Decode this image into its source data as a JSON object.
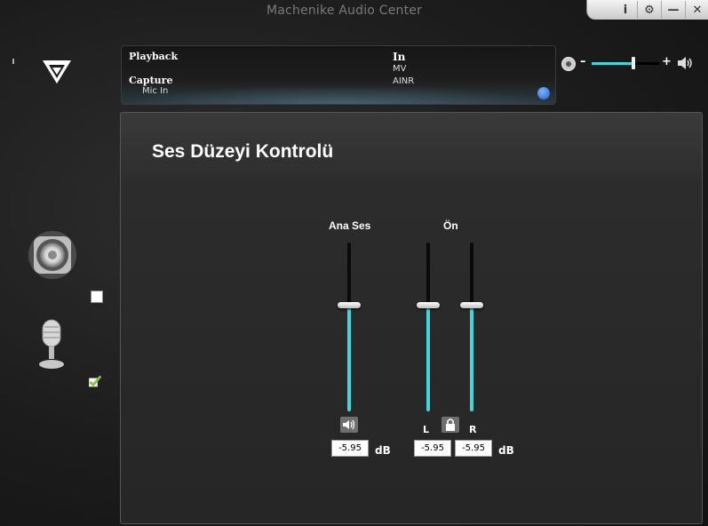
{
  "window": {
    "title": "Machenike Audio Center",
    "controls": [
      {
        "name": "info-button",
        "icon": "info-icon",
        "glyph": "i"
      },
      {
        "name": "settings-button",
        "icon": "gear-icon",
        "glyph": "⚙"
      },
      {
        "name": "minimize-button",
        "icon": "minimize-icon",
        "glyph": "—"
      },
      {
        "name": "close-button",
        "icon": "close-icon",
        "glyph": "✕"
      }
    ]
  },
  "status": {
    "playback_label": "Playback",
    "capture_label": "Capture",
    "capture_device": "Mic In",
    "in_label": "In",
    "in_items": [
      "MV",
      "AINR"
    ]
  },
  "master_volume": {
    "minus": "–",
    "plus": "+",
    "level": 0.62,
    "accent": "#3fd6e0"
  },
  "volume_control": {
    "title": "Ses Düzeyi Kontrolü",
    "master_label": "Ana Ses",
    "front_label": "Ön",
    "left_label": "L",
    "right_label": "R",
    "master_db": "-5.95",
    "left_db": "-5.95",
    "right_db": "-5.95",
    "unit": "dB",
    "master_level": 0.63,
    "left_level": 0.63,
    "right_level": 0.63
  },
  "sidebar": {
    "speaker_checked": false,
    "mic_checked": true
  }
}
